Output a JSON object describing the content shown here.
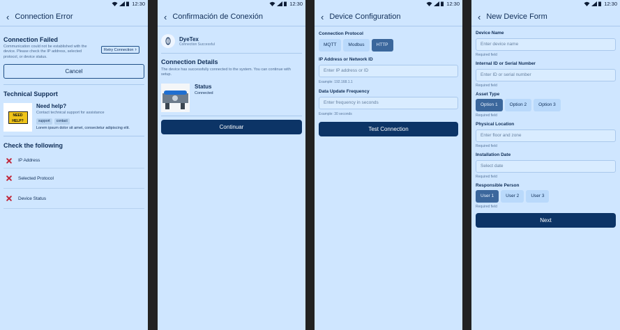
{
  "status": {
    "time": "12:30"
  },
  "screen1": {
    "title": "Connection Error",
    "failed_heading": "Connection Failed",
    "failed_text": "Communication could not be established with the device. Please check the IP address, selected protocol, or device status.",
    "retry_label": "Retry Connection",
    "cancel_label": "Cancel",
    "support_heading": "Technical Support",
    "help_logo_text": "NEED HELP?",
    "help_title": "Need help?",
    "help_sub": "Contact technical support for assistance",
    "tags": [
      "support",
      "contact"
    ],
    "lorem": "Lorem ipsum dolor sit amet, consectetur adipiscing elit.",
    "check_heading": "Check the following",
    "checks": [
      "IP Address",
      "Selected Protocol",
      "Device Status"
    ]
  },
  "screen2": {
    "title": "Confirmación de Conexión",
    "device_name": "DyeTex",
    "device_status": "Connection Successful",
    "details_heading": "Connection Details",
    "details_text": "The device has successfully connected to the system. You can continue with setup.",
    "status_label": "Status",
    "status_value": "Connected",
    "continue_label": "Continuar"
  },
  "screen3": {
    "title": "Device Configuration",
    "protocol_label": "Connection Protocol",
    "protocols": [
      "MQTT",
      "Modbus",
      "HTTP"
    ],
    "ip_label": "IP Address or Network ID",
    "ip_placeholder": "Enter IP address or ID",
    "ip_example": "Example: 192.168.1.1",
    "freq_label": "Data Update Frequency",
    "freq_placeholder": "Enter frequency in seconds",
    "freq_example": "Example: 30 seconds",
    "test_label": "Test Connection"
  },
  "screen4": {
    "title": "New Device Form",
    "required": "Required field",
    "name_label": "Device Name",
    "name_placeholder": "Enter device name",
    "id_label": "Internal ID or Serial Number",
    "id_placeholder": "Enter ID or serial number",
    "asset_label": "Asset Type",
    "asset_options": [
      "Option 1",
      "Option 2",
      "Option 3"
    ],
    "location_label": "Physical Location",
    "location_placeholder": "Enter floor and zone",
    "date_label": "Installation Date",
    "date_placeholder": "Select date",
    "person_label": "Responsible Person",
    "person_options": [
      "User 1",
      "User 2",
      "User 3"
    ],
    "next_label": "Next"
  }
}
